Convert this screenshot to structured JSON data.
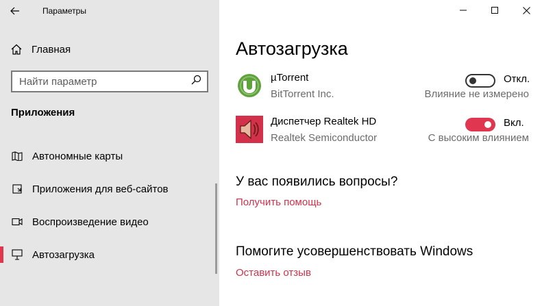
{
  "window": {
    "title": "Параметры",
    "controls": [
      "minimize-icon",
      "maximize-icon",
      "close-icon"
    ]
  },
  "sidebar": {
    "home_label": "Главная",
    "search_placeholder": "Найти параметр",
    "section_title": "Приложения",
    "items": [
      {
        "label": "Автономные карты",
        "icon": "map-icon",
        "active": false
      },
      {
        "label": "Приложения для веб-сайтов",
        "icon": "web-app-icon",
        "active": false
      },
      {
        "label": "Воспроизведение видео",
        "icon": "video-icon",
        "active": false
      },
      {
        "label": "Автозагрузка",
        "icon": "startup-icon",
        "active": true
      }
    ]
  },
  "main": {
    "title": "Автозагрузка",
    "apps": [
      {
        "name": "µTorrent",
        "publisher": "BitTorrent Inc.",
        "toggle_on": false,
        "state_label": "Откл.",
        "impact": "Влияние не измерено",
        "icon": "utorrent-icon"
      },
      {
        "name": "Диспетчер Realtek HD",
        "publisher": "Realtek Semiconductor",
        "toggle_on": true,
        "state_label": "Вкл.",
        "impact": "С высоким влиянием",
        "icon": "speaker-icon"
      }
    ],
    "questions": {
      "heading": "У вас появились вопросы?",
      "link": "Получить помощь"
    },
    "feedback": {
      "heading": "Помогите усовершенствовать Windows",
      "link": "Оставить отзыв"
    }
  },
  "colors": {
    "accent": "#e03650",
    "link": "#d3314b",
    "sidebar_bg": "#e6e6e6",
    "utorrent_green": "#5fa33a",
    "realtek_red": "#d3314b"
  }
}
